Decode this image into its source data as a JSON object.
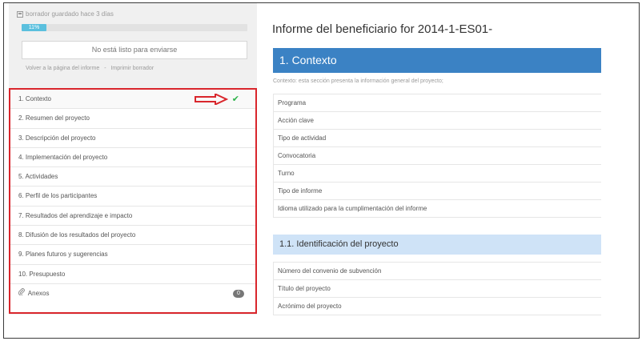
{
  "sidebar": {
    "draft_status": "borrador guardado hace 3 días",
    "progress_label": "11%",
    "progress_percent": 11,
    "submit_status": "No está listo para enviarse",
    "back_link": "Volver a la página del informe",
    "link_separator": "-",
    "print_link": "Imprimir borrador",
    "nav": [
      {
        "label": "1. Contexto",
        "active": true
      },
      {
        "label": "2. Resumen del proyecto"
      },
      {
        "label": "3. Descripción del proyecto"
      },
      {
        "label": "4. Implementación del proyecto"
      },
      {
        "label": "5. Actividades"
      },
      {
        "label": "6. Perfil de los participantes"
      },
      {
        "label": "7. Resultados del aprendizaje e impacto"
      },
      {
        "label": "8. Difusión de los resultados del proyecto"
      },
      {
        "label": "9. Planes futuros y sugerencias"
      },
      {
        "label": "10. Presupuesto"
      },
      {
        "label": "Anexos",
        "badge": "0"
      }
    ],
    "check_glyph": "✔",
    "annotation_color": "#d9262c"
  },
  "main": {
    "title": "Informe del beneficiario for 2014-1-ES01-",
    "section_title": "1. Contexto",
    "section_description": "Contexto: esta sección presenta la información general del proyecto;",
    "fields": [
      "Programa",
      "Acción clave",
      "Tipo de actividad",
      "Convocatoria",
      "Turno",
      "Tipo de informe",
      "Idioma utilizado para la cumplimentación del informe"
    ],
    "subsection_title": "1.1. Identificación del proyecto",
    "subsection_fields": [
      "Número del convenio de subvención",
      "Título del proyecto",
      "Acrónimo del proyecto"
    ],
    "accent_color": "#3b82c4"
  }
}
